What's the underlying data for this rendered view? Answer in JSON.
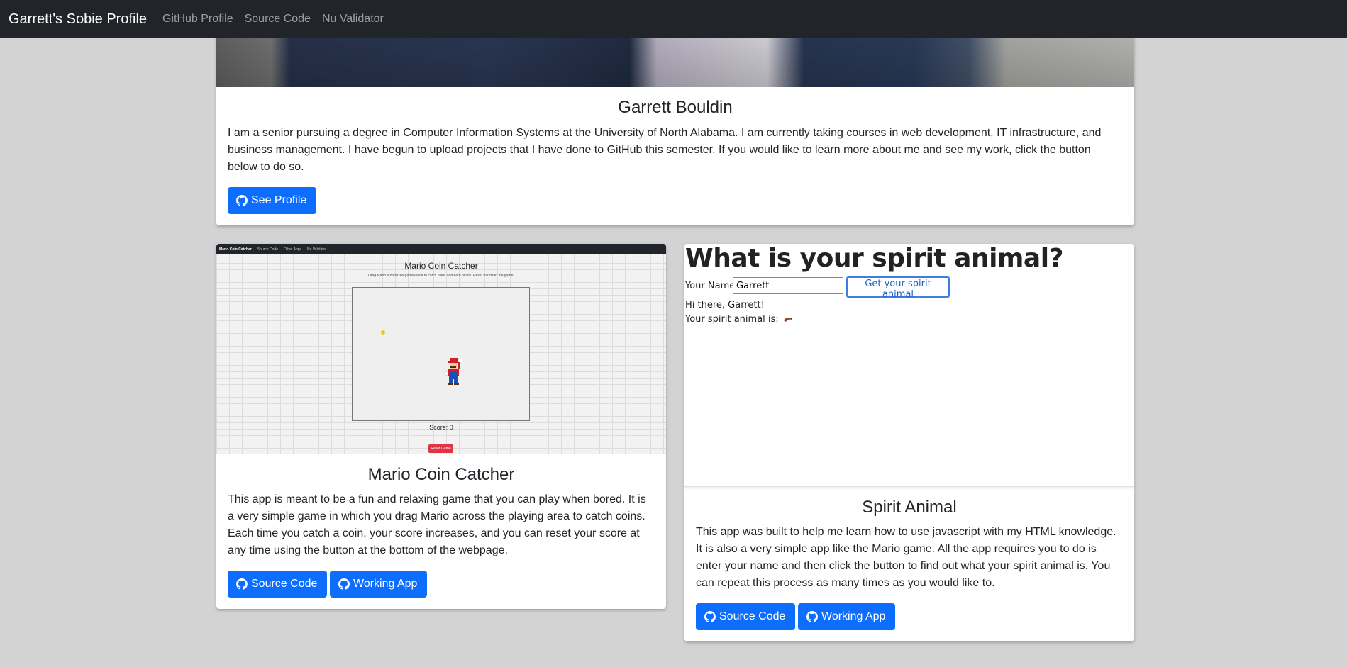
{
  "navbar": {
    "brand": "Garrett's Sobie Profile",
    "links": [
      "GitHub Profile",
      "Source Code",
      "Nu Validator"
    ]
  },
  "profile": {
    "name": "Garrett Bouldin",
    "bio": "I am a senior pursuing a degree in Computer Information Systems at the University of North Alabama. I am currently taking courses in web development, IT infrastructure, and business management. I have begun to upload projects that I have done to GitHub this semester. If you would like to learn more about me and see my work, click the button below to do so.",
    "button": "See Profile",
    "button_icon": "github-icon"
  },
  "mario": {
    "preview": {
      "nav_brand": "Mario Coin Catcher",
      "nav_links": [
        "Source Code",
        "Other Apps",
        "Nu Validator"
      ],
      "title": "Mario Coin Catcher",
      "subtitle": "Drag Mario around the gamespace to catch coins and earn points. Reset to restart the game.",
      "score": "Score: 0",
      "reset": "Reset Game"
    },
    "title": "Mario Coin Catcher",
    "description": "This app is meant to be a fun and relaxing game that you can play when bored. It is a very simple game in which you drag Mario across the playing area to catch coins. Each time you catch a coin, your score increases, and you can reset your score at any time using the button at the bottom of the webpage.",
    "source_button": "Source Code",
    "app_button": "Working App"
  },
  "spirit": {
    "preview": {
      "heading": "What is your spirit animal?",
      "name_label": "Your Name",
      "name_value": "Garrett",
      "button": "Get your spirit animal",
      "greeting": "Hi there, Garrett!",
      "result_label": "Your spirit animal is:"
    },
    "title": "Spirit Animal",
    "description": "This app was built to help me learn how to use javascript with my HTML knowledge. It is also a very simple app like the Mario game. All the app requires you to do is enter your name and then click the button to find out what your spirit animal is. You can repeat this process as many times as you would like to.",
    "source_button": "Source Code",
    "app_button": "Working App"
  },
  "colors": {
    "navbar": "#212529",
    "primary": "#0d6efd",
    "background": "#d3d3d3",
    "danger": "#dc3545"
  }
}
